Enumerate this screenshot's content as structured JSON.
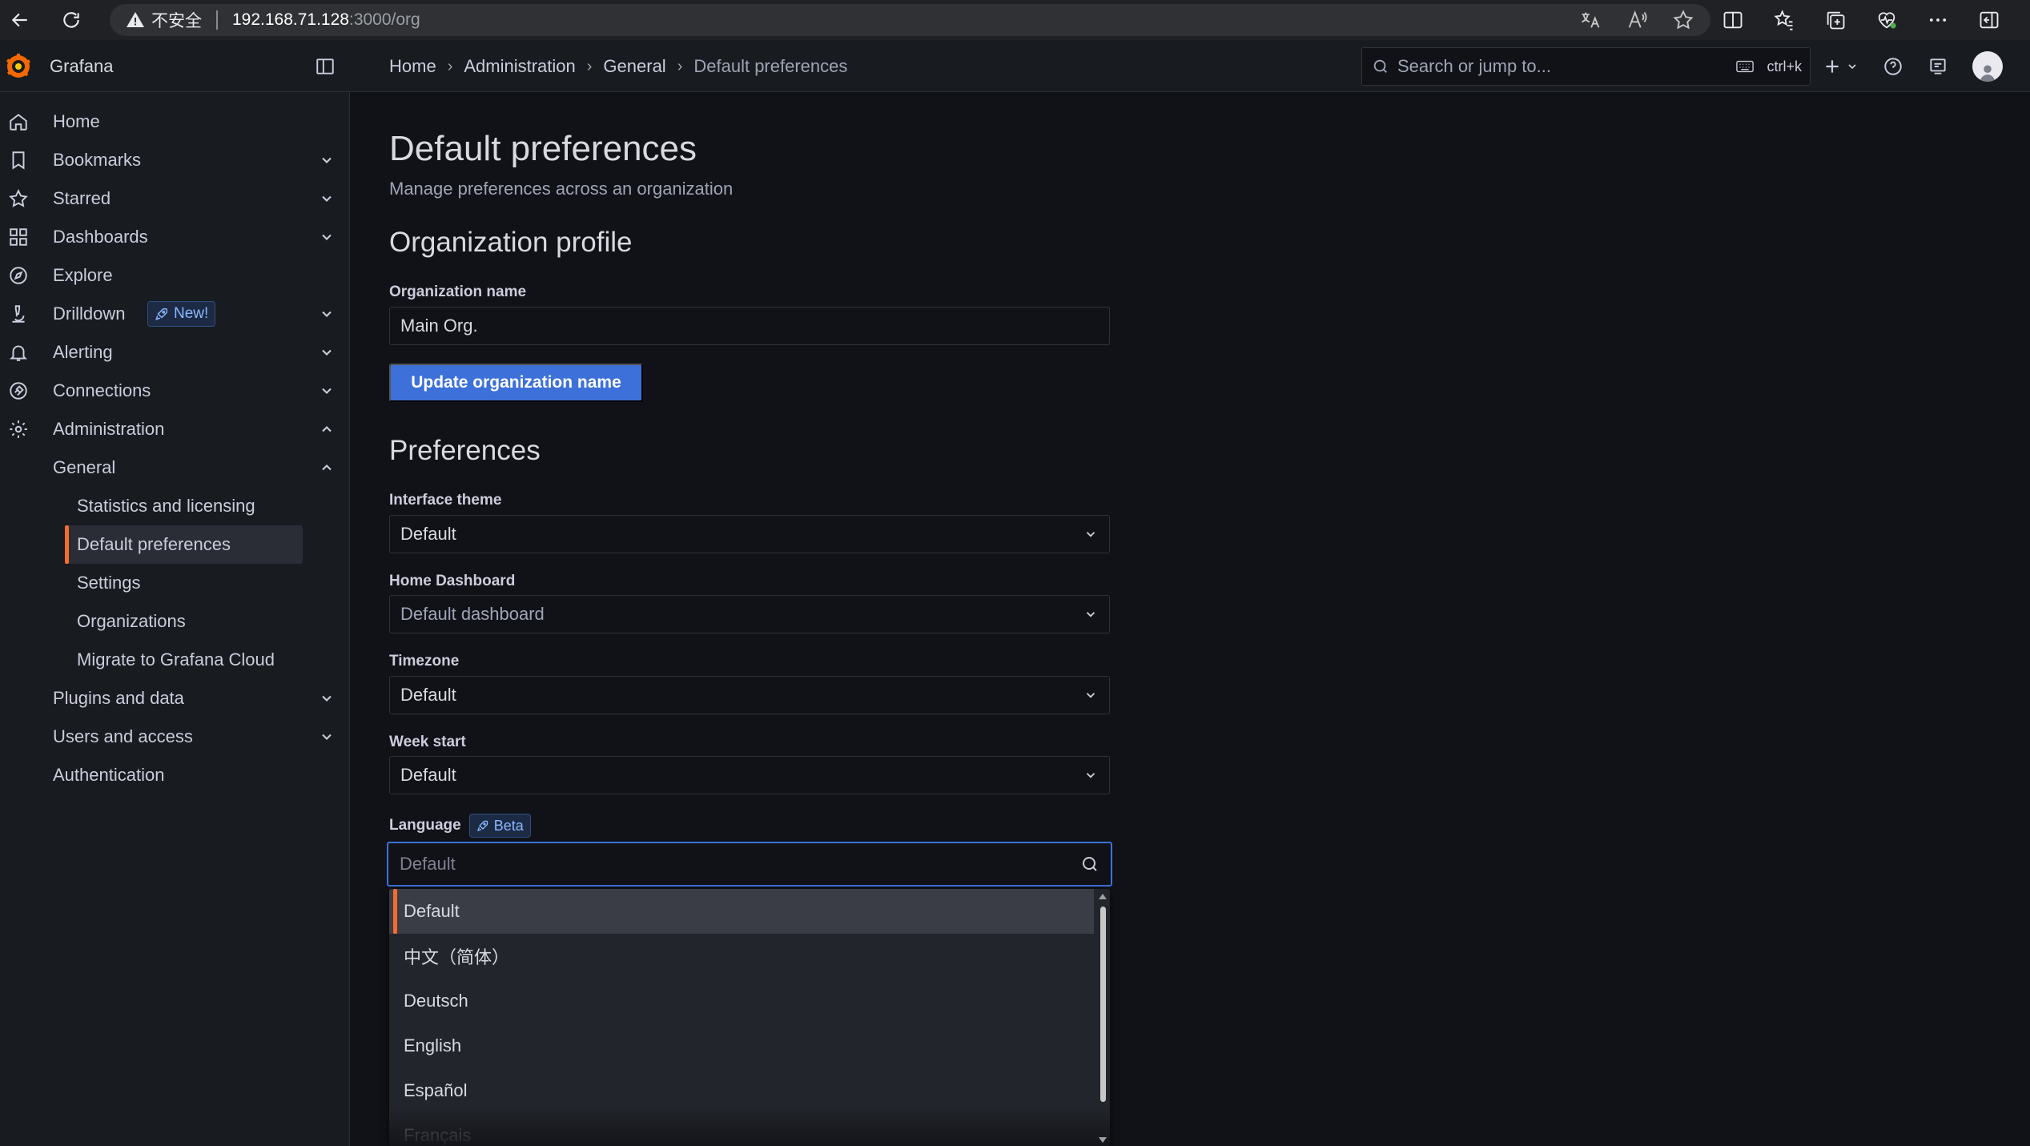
{
  "browser": {
    "security_label": "不安全",
    "url_host": "192.168.71.128",
    "url_rest": ":3000/org"
  },
  "topbar": {
    "brand": "Grafana",
    "breadcrumb": [
      "Home",
      "Administration",
      "General",
      "Default preferences"
    ],
    "search_placeholder": "Search or jump to...",
    "search_shortcut": "ctrl+k"
  },
  "sidebar": {
    "items": [
      {
        "label": "Home",
        "icon": "home-icon"
      },
      {
        "label": "Bookmarks",
        "icon": "bookmark-icon"
      },
      {
        "label": "Starred",
        "icon": "star-icon"
      },
      {
        "label": "Dashboards",
        "icon": "apps-icon"
      },
      {
        "label": "Explore",
        "icon": "compass-icon"
      },
      {
        "label": "Drilldown",
        "icon": "microscope-icon",
        "badge": "New!"
      },
      {
        "label": "Alerting",
        "icon": "bell-icon"
      },
      {
        "label": "Connections",
        "icon": "connections-icon"
      },
      {
        "label": "Administration",
        "icon": "cog-icon"
      }
    ],
    "admin_children": [
      "General",
      "Plugins and data",
      "Users and access",
      "Authentication"
    ],
    "general_children": [
      "Statistics and licensing",
      "Default preferences",
      "Settings",
      "Organizations",
      "Migrate to Grafana Cloud"
    ],
    "active_item": "Default preferences"
  },
  "main": {
    "title": "Default preferences",
    "subtitle": "Manage preferences across an organization",
    "org_section_title": "Organization profile",
    "org_name_label": "Organization name",
    "org_name_value": "Main Org.",
    "update_button": "Update organization name",
    "preferences_title": "Preferences",
    "interface_theme_label": "Interface theme",
    "interface_theme_value": "Default",
    "home_dashboard_label": "Home Dashboard",
    "home_dashboard_placeholder": "Default dashboard",
    "timezone_label": "Timezone",
    "timezone_value": "Default",
    "week_start_label": "Week start",
    "week_start_value": "Default",
    "language_label": "Language",
    "language_badge": "Beta",
    "language_placeholder": "Default",
    "language_options": [
      "Default",
      "中文（简体）",
      "Deutsch",
      "English",
      "Español",
      "Français"
    ],
    "language_selected": "Default"
  },
  "colors": {
    "accent": "#3d71d9",
    "active_indicator": "#f76b2c",
    "background": "#111217",
    "sidebar": "#181b1f"
  }
}
